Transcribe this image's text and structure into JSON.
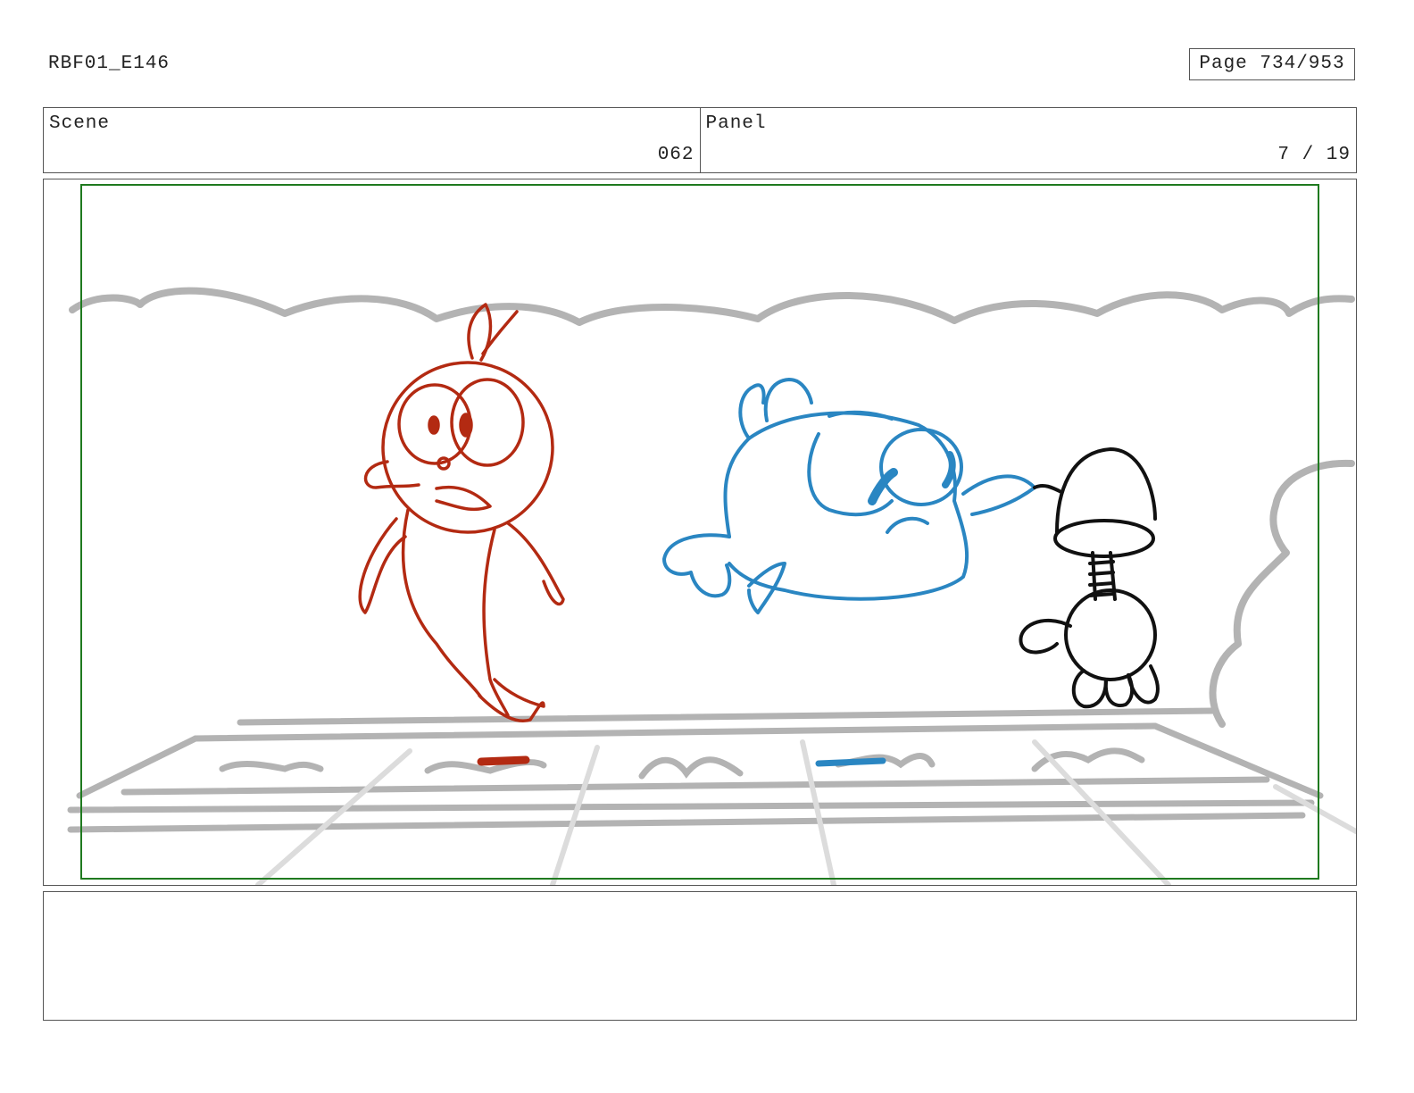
{
  "header": {
    "project_code": "RBF01_E146",
    "page": "Page 734/953"
  },
  "scene": {
    "label": "Scene",
    "value": "062"
  },
  "panel": {
    "label": "Panel",
    "value": "7 / 19"
  },
  "notes": {
    "text": ""
  },
  "colors": {
    "frame_guide": "#1f7a1f",
    "red_character": "#b32a12",
    "blue_character": "#2a86c2",
    "background_sketch": "#b3b3b3",
    "ink": "#111111"
  }
}
